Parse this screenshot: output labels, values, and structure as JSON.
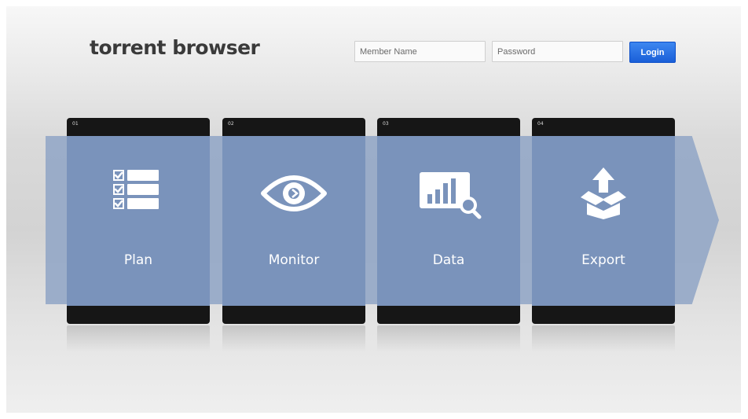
{
  "header": {
    "brand": "torrent browser",
    "member_placeholder": "Member Name",
    "password_placeholder": "Password",
    "login_label": "Login"
  },
  "steps": [
    {
      "num": "01",
      "label": "Plan",
      "icon": "checklist-icon"
    },
    {
      "num": "02",
      "label": "Monitor",
      "icon": "eye-icon"
    },
    {
      "num": "03",
      "label": "Data",
      "icon": "chart-search-icon"
    },
    {
      "num": "04",
      "label": "Export",
      "icon": "export-box-icon"
    }
  ],
  "colors": {
    "accent": "#1a5fd8",
    "card": "#7a93bb",
    "band": "#8fa4c6",
    "bar": "#161616"
  }
}
